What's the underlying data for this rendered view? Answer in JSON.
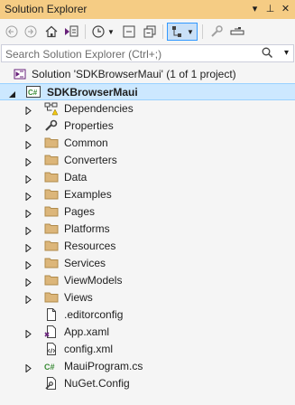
{
  "window": {
    "title": "Solution Explorer",
    "title_buttons": [
      "▾",
      "⊥",
      "✕"
    ]
  },
  "search": {
    "placeholder": "Search Solution Explorer (Ctrl+;)"
  },
  "solution": {
    "label": "Solution 'SDKBrowserMaui' (1 of 1 project)"
  },
  "project": {
    "label": "SDKBrowserMaui",
    "icon_text": "C#"
  },
  "items": [
    {
      "label": "Dependencies",
      "icon": "dependencies-icon",
      "expandable": true
    },
    {
      "label": "Properties",
      "icon": "properties-icon",
      "expandable": true
    },
    {
      "label": "Common",
      "icon": "folder-icon",
      "expandable": true
    },
    {
      "label": "Converters",
      "icon": "folder-icon",
      "expandable": true
    },
    {
      "label": "Data",
      "icon": "folder-icon",
      "expandable": true
    },
    {
      "label": "Examples",
      "icon": "folder-icon",
      "expandable": true
    },
    {
      "label": "Pages",
      "icon": "folder-icon",
      "expandable": true
    },
    {
      "label": "Platforms",
      "icon": "folder-icon",
      "expandable": true
    },
    {
      "label": "Resources",
      "icon": "folder-icon",
      "expandable": true
    },
    {
      "label": "Services",
      "icon": "folder-icon",
      "expandable": true
    },
    {
      "label": "ViewModels",
      "icon": "folder-icon",
      "expandable": true
    },
    {
      "label": "Views",
      "icon": "folder-icon",
      "expandable": true
    },
    {
      "label": ".editorconfig",
      "icon": "file-icon",
      "expandable": false
    },
    {
      "label": "App.xaml",
      "icon": "xaml-file-icon",
      "expandable": true
    },
    {
      "label": "config.xml",
      "icon": "xml-file-icon",
      "expandable": false
    },
    {
      "label": "MauiProgram.cs",
      "icon": "csharp-file-icon",
      "expandable": true
    },
    {
      "label": "NuGet.Config",
      "icon": "config-file-icon",
      "expandable": false
    }
  ],
  "colors": {
    "title_bar": "#f5cc84",
    "selection": "#cce8ff",
    "folder": "#dcb67a",
    "csharp": "#388a34",
    "project_purple": "#68217a"
  }
}
